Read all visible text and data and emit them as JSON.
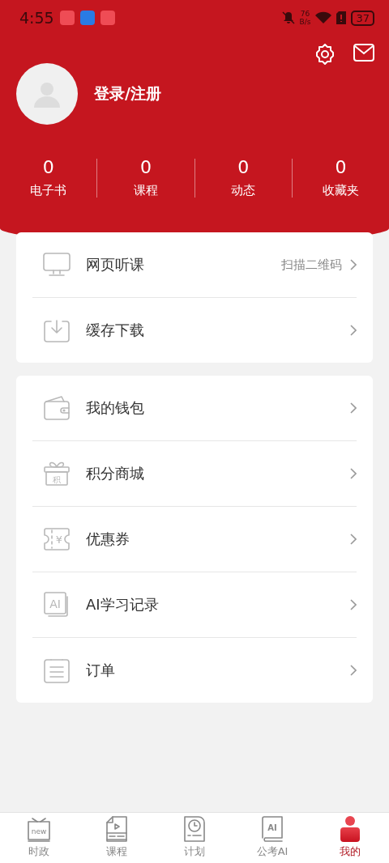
{
  "status_bar": {
    "time": "4:55",
    "net_speed": "76",
    "net_unit": "B/s",
    "battery": "37"
  },
  "profile": {
    "login_label": "登录/注册"
  },
  "stats": [
    {
      "value": "0",
      "label": "电子书"
    },
    {
      "value": "0",
      "label": "课程"
    },
    {
      "value": "0",
      "label": "动态"
    },
    {
      "value": "0",
      "label": "收藏夹"
    }
  ],
  "menu_groups": [
    [
      {
        "kind": "monitor",
        "label": "网页听课",
        "hint": "扫描二维码"
      },
      {
        "kind": "download",
        "label": "缓存下载"
      }
    ],
    [
      {
        "kind": "wallet",
        "label": "我的钱包"
      },
      {
        "kind": "gift",
        "icon_text": "积",
        "label": "积分商城"
      },
      {
        "kind": "coupon",
        "icon_text": "¥",
        "label": "优惠券"
      },
      {
        "kind": "ai",
        "icon_text": "AI",
        "label": "AI学习记录"
      },
      {
        "kind": "order",
        "label": "订单"
      }
    ]
  ],
  "tabs": [
    {
      "kind": "tv",
      "icon_text": "new",
      "label": "时政",
      "selected": false
    },
    {
      "kind": "video",
      "label": "课程",
      "selected": false
    },
    {
      "kind": "clock",
      "label": "计划",
      "selected": false
    },
    {
      "kind": "book",
      "icon_text": "AI",
      "label": "公考AI",
      "selected": false
    },
    {
      "kind": "person",
      "label": "我的",
      "selected": true
    }
  ]
}
